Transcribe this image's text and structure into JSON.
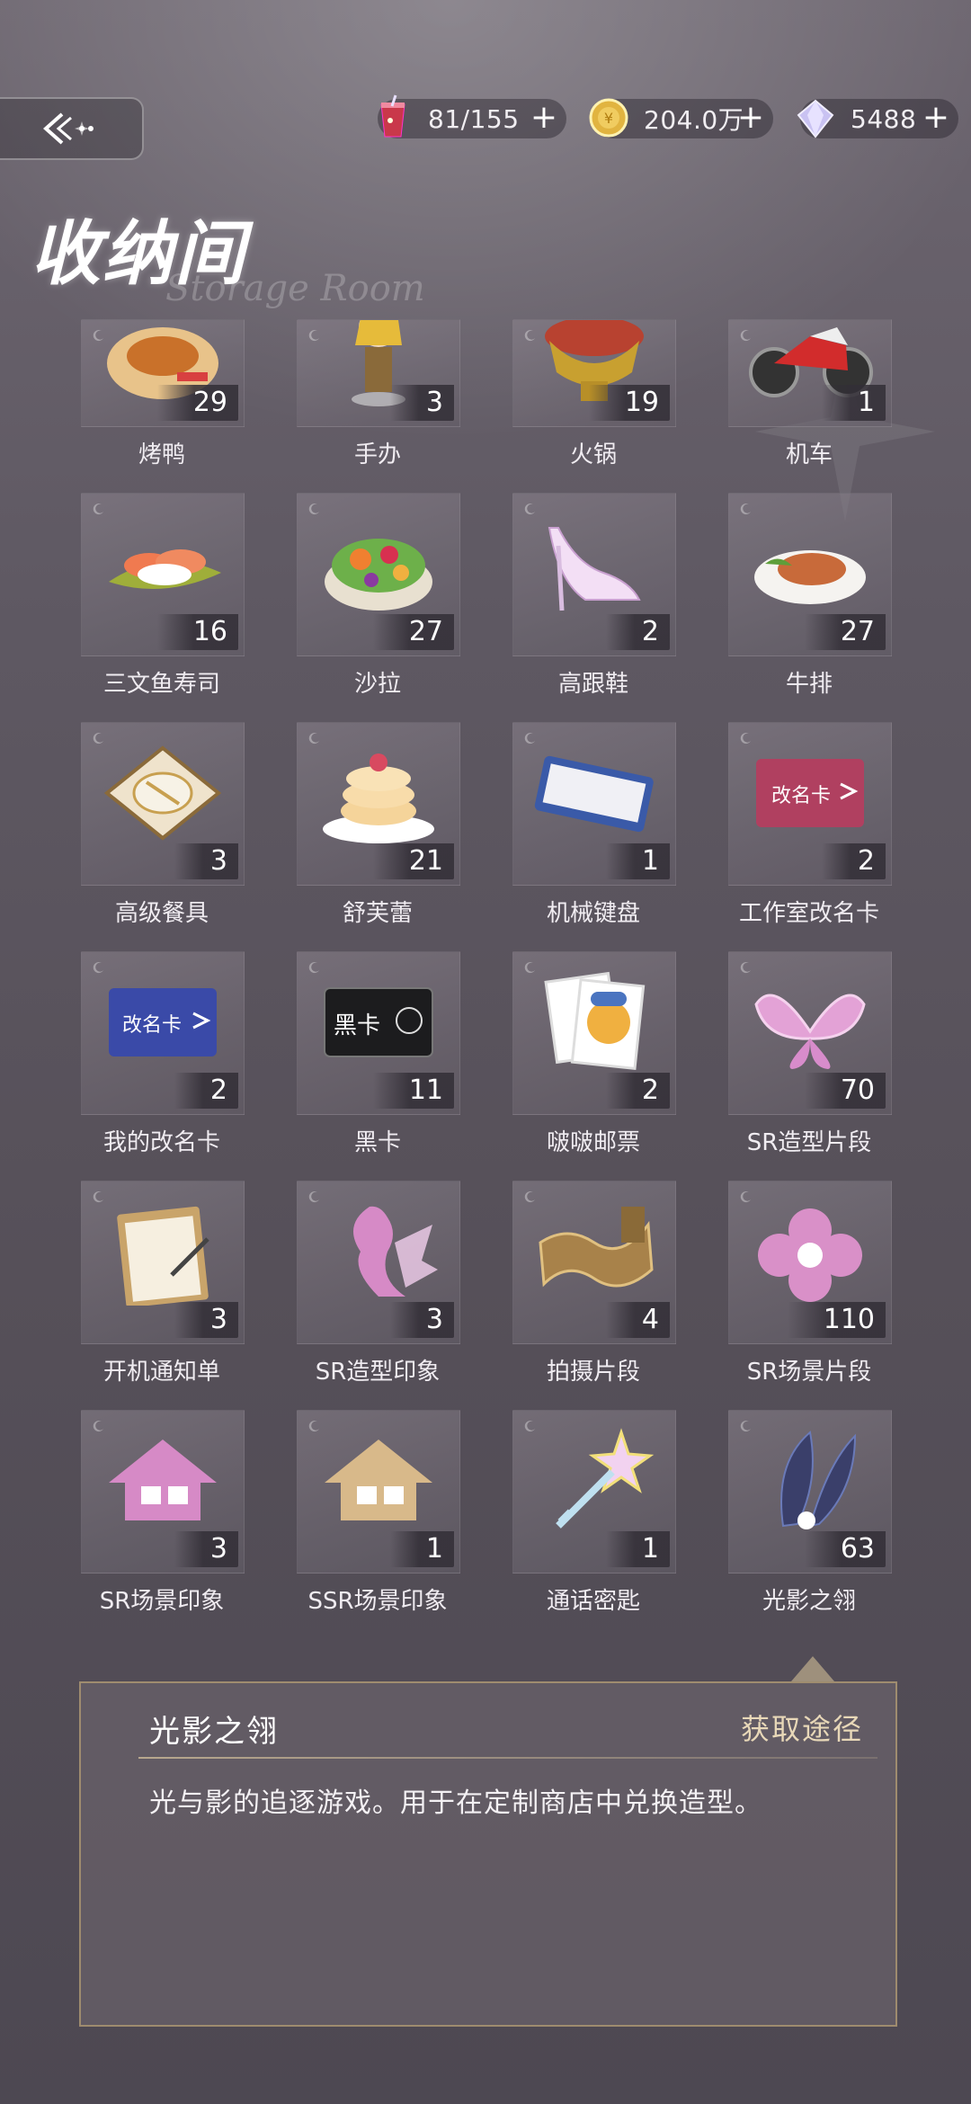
{
  "header": {
    "back_icon": "back-arrow-icon",
    "resources": [
      {
        "icon": "drink-icon",
        "value": "81/155",
        "plus": "+"
      },
      {
        "icon": "coin-icon",
        "value": "204.0万",
        "plus": "+"
      },
      {
        "icon": "diamond-icon",
        "value": "5488",
        "plus": "+"
      }
    ]
  },
  "title": {
    "main": "收纳间",
    "subtitle": "Storage Room"
  },
  "items": [
    {
      "name": "烤鸭",
      "count": "29",
      "icon": "roast-duck-icon"
    },
    {
      "name": "手办",
      "count": "3",
      "icon": "figure-icon"
    },
    {
      "name": "火锅",
      "count": "19",
      "icon": "hotpot-icon"
    },
    {
      "name": "机车",
      "count": "1",
      "icon": "motorcycle-icon"
    },
    {
      "name": "三文鱼寿司",
      "count": "16",
      "icon": "salmon-sushi-icon"
    },
    {
      "name": "沙拉",
      "count": "27",
      "icon": "salad-icon"
    },
    {
      "name": "高跟鞋",
      "count": "2",
      "icon": "high-heel-icon"
    },
    {
      "name": "牛排",
      "count": "27",
      "icon": "steak-icon"
    },
    {
      "name": "高级餐具",
      "count": "3",
      "icon": "tableware-icon"
    },
    {
      "name": "舒芙蕾",
      "count": "21",
      "icon": "souffle-icon"
    },
    {
      "name": "机械键盘",
      "count": "1",
      "icon": "keyboard-icon"
    },
    {
      "name": "工作室改名卡",
      "count": "2",
      "icon": "studio-rename-card-icon"
    },
    {
      "name": "我的改名卡",
      "count": "2",
      "icon": "rename-card-icon"
    },
    {
      "name": "黑卡",
      "count": "11",
      "icon": "black-card-icon"
    },
    {
      "name": "啵啵邮票",
      "count": "2",
      "icon": "stamp-icon"
    },
    {
      "name": "SR造型片段",
      "count": "70",
      "icon": "butterfly-icon"
    },
    {
      "name": "开机通知单",
      "count": "3",
      "icon": "clipboard-icon"
    },
    {
      "name": "SR造型印象",
      "count": "3",
      "icon": "silhouette-icon"
    },
    {
      "name": "拍摄片段",
      "count": "4",
      "icon": "film-reel-icon"
    },
    {
      "name": "SR场景片段",
      "count": "110",
      "icon": "clover-icon"
    },
    {
      "name": "SR场景印象",
      "count": "3",
      "icon": "house-icon"
    },
    {
      "name": "SSR场景印象",
      "count": "1",
      "icon": "house-gold-icon"
    },
    {
      "name": "通话密匙",
      "count": "1",
      "icon": "star-key-icon"
    },
    {
      "name": "光影之翎",
      "count": "63",
      "icon": "feather-icon"
    }
  ],
  "detail": {
    "title": "光影之翎",
    "link": "获取途径",
    "description": "光与影的追逐游戏。用于在定制商店中兑换造型。"
  },
  "colors": {
    "accent_gold": "#d2b478",
    "panel_bg": "#6e666e"
  }
}
